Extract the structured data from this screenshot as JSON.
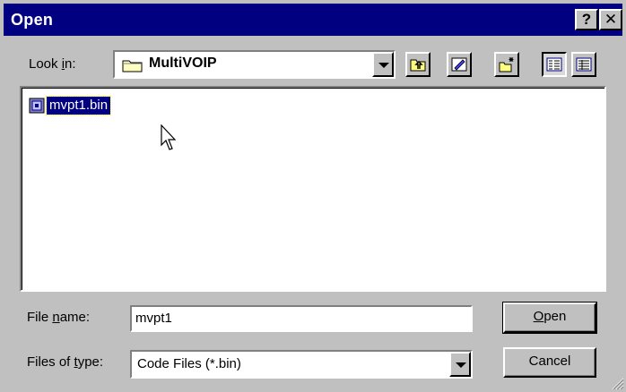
{
  "window": {
    "title": "Open",
    "help_label": "?",
    "close_label": "✕"
  },
  "toolbar": {
    "lookin_label": "Look in:",
    "lookin_value": "MultiVOIP"
  },
  "file_list": {
    "items": [
      {
        "name": "mvpt1.bin",
        "selected": true,
        "icon": "bin-file-icon"
      }
    ]
  },
  "form": {
    "filename_label": "File name:",
    "filename_value": "mvpt1",
    "filetype_label": "Files of type:",
    "filetype_value": "Code Files (*.bin)"
  },
  "buttons": {
    "open_label": "Open",
    "cancel_label": "Cancel"
  },
  "colors": {
    "titlebar": "#000080",
    "face": "#c0c0c0",
    "selection": "#000080"
  }
}
